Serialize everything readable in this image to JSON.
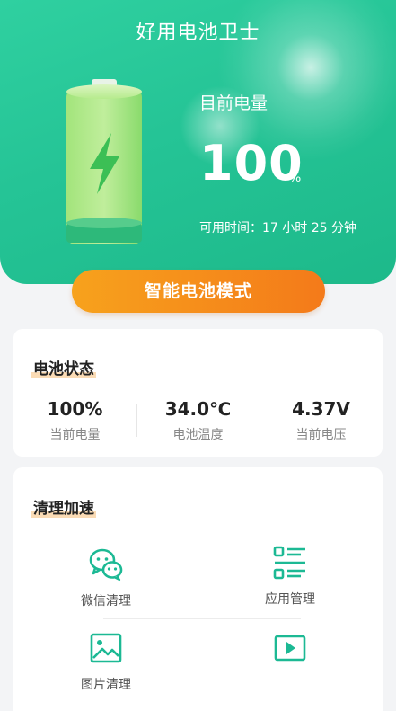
{
  "header": {
    "app_title": "好用电池卫士",
    "level_label": "目前电量",
    "level_value": "100",
    "level_unit": "%",
    "remaining_time": "可用时间：17 小时 25 分钟"
  },
  "smart_mode_button": "智能电池模式",
  "battery_status": {
    "title": "电池状态",
    "stats": [
      {
        "value": "100%",
        "label": "当前电量"
      },
      {
        "value": "34.0℃",
        "label": "电池温度"
      },
      {
        "value": "4.37V",
        "label": "当前电压"
      }
    ]
  },
  "cleanup": {
    "title": "清理加速",
    "tools": [
      {
        "label": "微信清理",
        "icon": "wechat-icon"
      },
      {
        "label": "应用管理",
        "icon": "app-list-icon"
      },
      {
        "label": "图片清理",
        "icon": "image-icon"
      },
      {
        "label": "",
        "icon": "video-icon"
      }
    ]
  },
  "colors": {
    "header_green": "#25c496",
    "accent_orange": "#f48a1a",
    "icon_teal": "#1cb994"
  }
}
